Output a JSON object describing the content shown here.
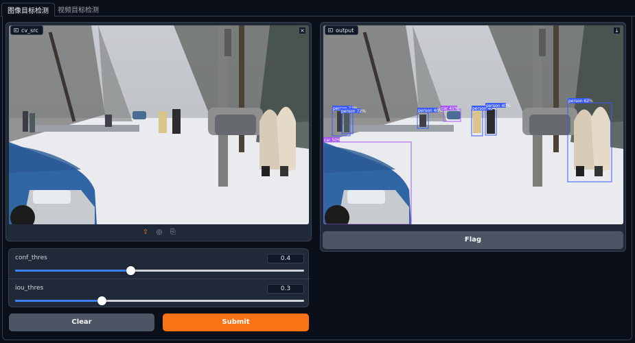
{
  "tabs": [
    "图像目标检测",
    "视频目标检测"
  ],
  "input_image": {
    "label": "cv_src",
    "close_glyph": "×"
  },
  "output_image": {
    "label": "output",
    "download_glyph": "⤓"
  },
  "toolbar_icons": [
    "upload-icon",
    "webcam-icon",
    "clipboard-icon"
  ],
  "sliders": [
    {
      "label": "conf_thres",
      "value": "0.4",
      "fraction": 0.4
    },
    {
      "label": "iou_thres",
      "value": "0.3",
      "fraction": 0.3
    }
  ],
  "buttons": {
    "clear": "Clear",
    "submit": "Submit",
    "flag": "Flag"
  },
  "detections": [
    {
      "label": "person 71%"
    },
    {
      "label": "person 72%"
    },
    {
      "label": "person 40%"
    },
    {
      "label": "car 41%"
    },
    {
      "label": "person 40%"
    },
    {
      "label": "person 40%"
    },
    {
      "label": "person 62%"
    },
    {
      "label": "car 50%"
    }
  ],
  "colors": {
    "accent": "#f97316",
    "slider": "#3b82f6",
    "bg": "#0b0f19",
    "panel": "#1f2937",
    "box_blue": "#3b5bff",
    "box_purple": "#a855f7"
  }
}
